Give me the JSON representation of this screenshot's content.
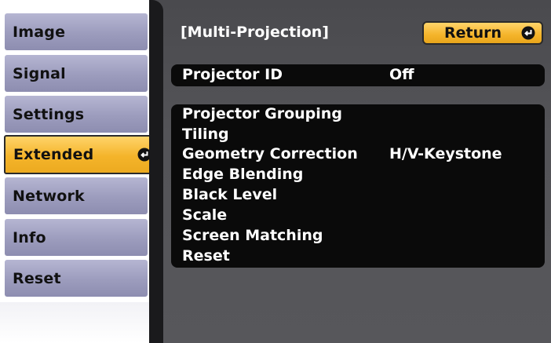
{
  "sidebar": {
    "items": [
      {
        "label": "Image",
        "selected": false
      },
      {
        "label": "Signal",
        "selected": false
      },
      {
        "label": "Settings",
        "selected": false
      },
      {
        "label": "Extended",
        "selected": true,
        "icon": "enter-icon"
      },
      {
        "label": "Network",
        "selected": false
      },
      {
        "label": "Info",
        "selected": false
      },
      {
        "label": "Reset",
        "selected": false
      }
    ]
  },
  "header": {
    "title": "[Multi-Projection]",
    "return_label": "Return",
    "return_icon": "enter-icon"
  },
  "main": {
    "projector_id": {
      "label": "Projector ID",
      "value": "Off"
    },
    "items": [
      {
        "label": "Projector Grouping",
        "value": ""
      },
      {
        "label": "Tiling",
        "value": ""
      },
      {
        "label": "Geometry Correction",
        "value": "H/V-Keystone"
      },
      {
        "label": "Edge Blending",
        "value": ""
      },
      {
        "label": "Black Level",
        "value": ""
      },
      {
        "label": "Scale",
        "value": ""
      },
      {
        "label": "Screen Matching",
        "value": ""
      },
      {
        "label": "Reset",
        "value": ""
      }
    ]
  },
  "colors": {
    "accent": "#f4b42a",
    "sidebar_item": "#9c9cbd",
    "panel_bg": "#545458",
    "row_bg": "#0a0a0a",
    "text_light": "#ffffff"
  }
}
